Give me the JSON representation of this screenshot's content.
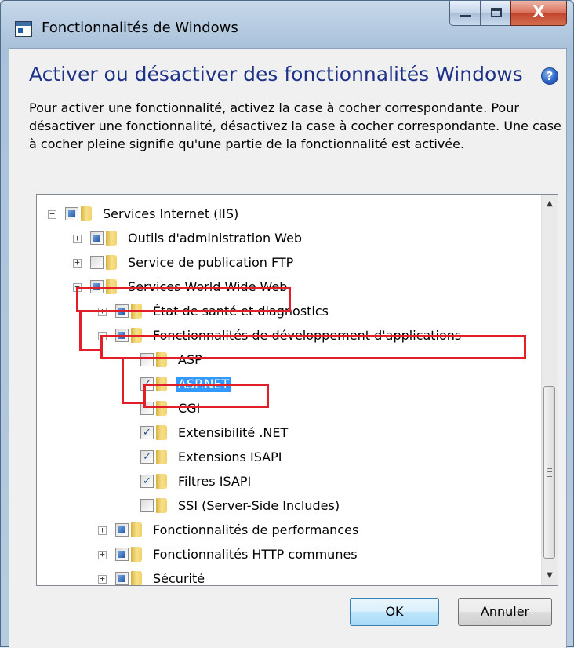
{
  "window": {
    "title": "Fonctionnalités de Windows",
    "controls": {
      "minimize": "minimize",
      "maximize": "maximize",
      "close": "X"
    }
  },
  "heading": "Activer ou désactiver des fonctionnalités Windows",
  "help_icon": "?",
  "description": "Pour activer une fonctionnalité, activez la case à cocher correspondante. Pour désactiver une fonctionnalité, désactivez la case à cocher correspondante. Une case à cocher pleine signifie qu'une partie de la fonctionnalité est activée.",
  "tree": {
    "items": [
      {
        "label": "Services Internet (IIS)",
        "state": "partial",
        "expander": "minus"
      },
      {
        "label": "Outils d'administration Web",
        "state": "partial",
        "expander": "plus"
      },
      {
        "label": "Service de publication FTP",
        "state": "unchecked",
        "expander": "plus"
      },
      {
        "label": "Services World Wide Web",
        "state": "partial",
        "expander": "minus"
      },
      {
        "label": "État de santé et diagnostics",
        "state": "partial",
        "expander": "plus"
      },
      {
        "label": "Fonctionnalités de développement d'applications",
        "state": "partial",
        "expander": "minus"
      },
      {
        "label": "ASP",
        "state": "unchecked",
        "expander": "none"
      },
      {
        "label": "ASP.NET",
        "state": "checked",
        "expander": "none",
        "selected": true
      },
      {
        "label": "CGI",
        "state": "unchecked",
        "expander": "none"
      },
      {
        "label": "Extensibilité .NET",
        "state": "checked",
        "expander": "none"
      },
      {
        "label": "Extensions ISAPI",
        "state": "checked",
        "expander": "none"
      },
      {
        "label": "Filtres ISAPI",
        "state": "checked",
        "expander": "none"
      },
      {
        "label": "SSI (Server-Side Includes)",
        "state": "unchecked",
        "expander": "none"
      },
      {
        "label": "Fonctionnalités de performances",
        "state": "partial",
        "expander": "plus"
      },
      {
        "label": "Fonctionnalités HTTP communes",
        "state": "partial",
        "expander": "plus"
      },
      {
        "label": "Sécurité",
        "state": "partial",
        "expander": "plus"
      }
    ]
  },
  "buttons": {
    "ok": "OK",
    "cancel": "Annuler"
  },
  "colors": {
    "heading": "#1e3287",
    "annotation": "#e21e26",
    "selection": "#3399ff"
  },
  "glyphs": {
    "checkmark": "✓",
    "plus": "+",
    "minus": "−",
    "scroll_up": "▲",
    "scroll_down": "▼"
  }
}
